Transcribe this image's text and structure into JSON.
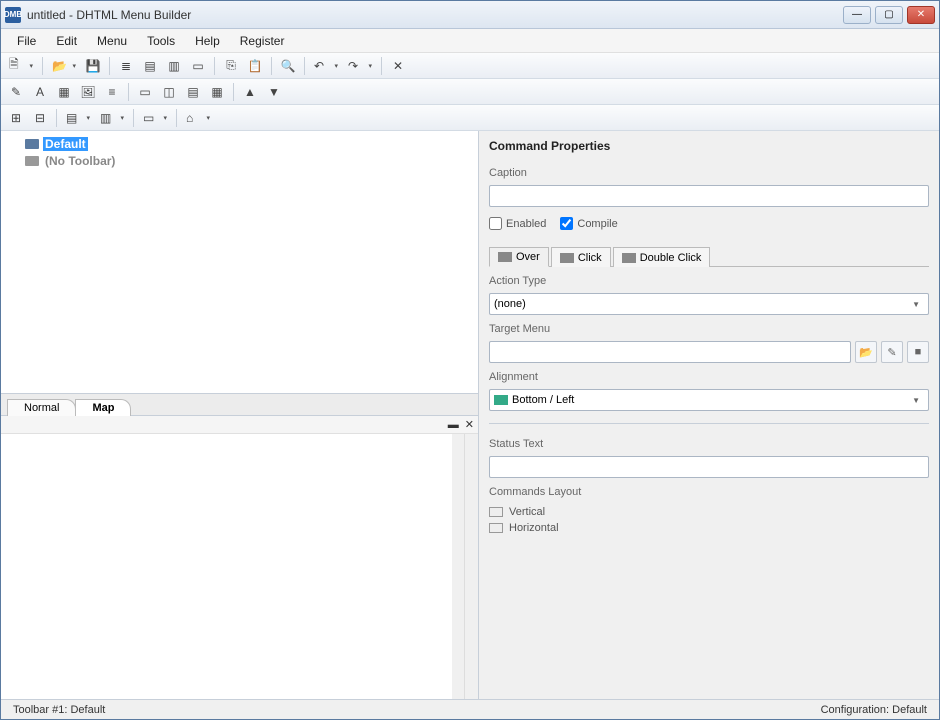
{
  "window": {
    "title": "untitled - DHTML Menu Builder"
  },
  "menubar": [
    "File",
    "Edit",
    "Menu",
    "Tools",
    "Help",
    "Register"
  ],
  "tree": {
    "items": [
      {
        "label": "Default",
        "selected": true
      },
      {
        "label": "(No Toolbar)",
        "selected": false
      }
    ]
  },
  "tabs": {
    "left": [
      "Normal",
      "Map"
    ],
    "active": 1
  },
  "properties": {
    "title": "Command Properties",
    "caption_label": "Caption",
    "caption_value": "",
    "enabled_label": "Enabled",
    "enabled_checked": false,
    "compile_label": "Compile",
    "compile_checked": true,
    "event_tabs": [
      "Over",
      "Click",
      "Double Click"
    ],
    "event_active": 0,
    "action_type_label": "Action Type",
    "action_type_value": "(none)",
    "target_menu_label": "Target Menu",
    "target_menu_value": "",
    "alignment_label": "Alignment",
    "alignment_value": "Bottom / Left",
    "status_text_label": "Status Text",
    "status_text_value": "",
    "commands_layout_label": "Commands Layout",
    "layout_vertical": "Vertical",
    "layout_horizontal": "Horizontal"
  },
  "statusbar": {
    "left": "Toolbar #1: Default",
    "right": "Configuration: Default"
  }
}
